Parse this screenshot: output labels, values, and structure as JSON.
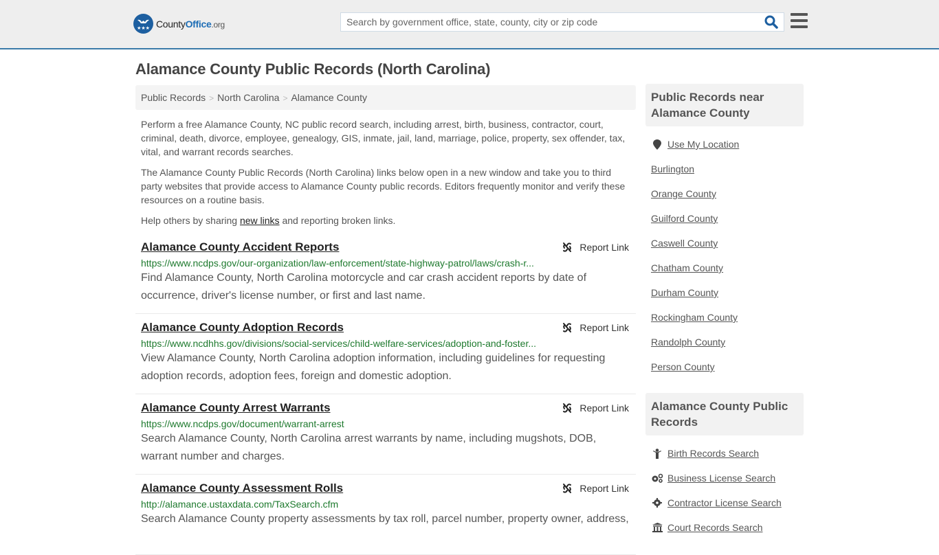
{
  "site": {
    "logo_prefix": "County",
    "logo_bold": "Office",
    "logo_suffix": ".org"
  },
  "search": {
    "placeholder": "Search by government office, state, county, city or zip code",
    "value": ""
  },
  "page": {
    "title": "Alamance County Public Records (North Carolina)"
  },
  "breadcrumb": [
    {
      "label": "Public Records"
    },
    {
      "label": "North Carolina"
    },
    {
      "label": "Alamance County"
    }
  ],
  "breadcrumb_sep": ">",
  "intro": {
    "p1": "Perform a free Alamance County, NC public record search, including arrest, birth, business, contractor, court, criminal, death, divorce, employee, genealogy, GIS, inmate, jail, land, marriage, police, property, sex offender, tax, vital, and warrant records searches.",
    "p2": "The Alamance County Public Records (North Carolina) links below open in a new window and take you to third party websites that provide access to Alamance County public records. Editors frequently monitor and verify these resources on a routine basis.",
    "p3_before": "Help others by sharing ",
    "p3_link": "new links",
    "p3_after": " and reporting broken links."
  },
  "report_label": "Report Link",
  "records": [
    {
      "title": "Alamance County Accident Reports",
      "url": "https://www.ncdps.gov/our-organization/law-enforcement/state-highway-patrol/laws/crash-r...",
      "desc": "Find Alamance County, North Carolina motorcycle and car crash accident reports by date of occurrence, driver's license number, or first and last name."
    },
    {
      "title": "Alamance County Adoption Records",
      "url": "https://www.ncdhhs.gov/divisions/social-services/child-welfare-services/adoption-and-foster...",
      "desc": "View Alamance County, North Carolina adoption information, including guidelines for requesting adoption records, adoption fees, foreign and domestic adoption."
    },
    {
      "title": "Alamance County Arrest Warrants",
      "url": "https://www.ncdps.gov/document/warrant-arrest",
      "desc": "Search Alamance County, North Carolina arrest warrants by name, including mugshots, DOB, warrant number and charges."
    },
    {
      "title": "Alamance County Assessment Rolls",
      "url": "http://alamance.ustaxdata.com/TaxSearch.cfm",
      "desc": "Search Alamance County property assessments by tax roll, parcel number, property owner, address,"
    }
  ],
  "sidebar": {
    "nearby_heading": "Public Records near Alamance County",
    "use_location": "Use My Location",
    "nearby": [
      "Burlington",
      "Orange County",
      "Guilford County",
      "Caswell County",
      "Chatham County",
      "Durham County",
      "Rockingham County",
      "Randolph County",
      "Person County"
    ],
    "records_heading": "Alamance County Public Records",
    "record_links": [
      {
        "label": "Birth Records Search",
        "icon": "child-icon"
      },
      {
        "label": "Business License Search",
        "icon": "gears-icon"
      },
      {
        "label": "Contractor License Search",
        "icon": "gear-icon"
      },
      {
        "label": "Court Records Search",
        "icon": "courthouse-icon"
      }
    ]
  },
  "colors": {
    "header_bg": "#eeeeee",
    "header_border": "#3a7aa8",
    "brand_blue": "#1d5fa0",
    "url_green": "#1e7a2e"
  }
}
